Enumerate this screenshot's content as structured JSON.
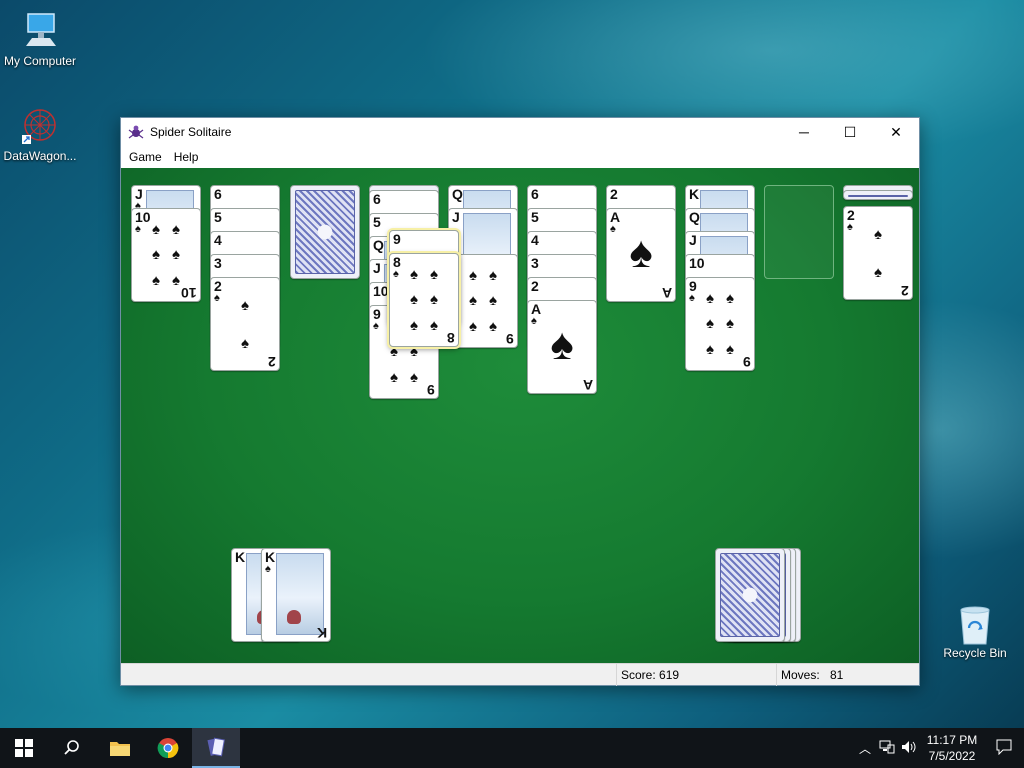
{
  "desktop": {
    "icons": [
      {
        "label": "My Computer"
      },
      {
        "label": "DataWagon..."
      },
      {
        "label": "Recycle Bin"
      }
    ]
  },
  "window": {
    "title": "Spider Solitaire",
    "controls": {
      "minimize": "─",
      "maximize": "☐",
      "close": "✕"
    },
    "menu": [
      "Game",
      "Help"
    ]
  },
  "game": {
    "suit": "♠",
    "tableau": [
      {
        "column": 1,
        "cards": [
          "J",
          "10"
        ]
      },
      {
        "column": 2,
        "cards": [
          "6",
          "5",
          "4",
          "3",
          "2"
        ]
      },
      {
        "column": 3,
        "cards": [
          "face-down"
        ]
      },
      {
        "column": 4,
        "cards": [
          "6",
          "5",
          "Q",
          "J",
          "10",
          "9"
        ]
      },
      {
        "column": 5,
        "cards": [
          "Q",
          "J",
          "9"
        ]
      },
      {
        "column": 6,
        "cards": [
          "6",
          "5",
          "4",
          "3",
          "2",
          "A"
        ]
      },
      {
        "column": 7,
        "cards": [
          "2",
          "A"
        ]
      },
      {
        "column": 8,
        "cards": [
          "K",
          "Q",
          "J",
          "10",
          "9"
        ]
      },
      {
        "column": 9,
        "cards": []
      },
      {
        "column": 10,
        "cards": [
          "2"
        ]
      }
    ],
    "dragging": [
      "9",
      "8"
    ],
    "completed": [
      "K",
      "K"
    ]
  },
  "status": {
    "score_label": "Score: 619",
    "moves_label": "Moves:",
    "moves_value": "81"
  },
  "taskbar": {
    "apps": [
      "start",
      "search",
      "file-explorer",
      "chrome",
      "spider-solitaire"
    ],
    "time": "11:17 PM",
    "date": "7/5/2022"
  }
}
